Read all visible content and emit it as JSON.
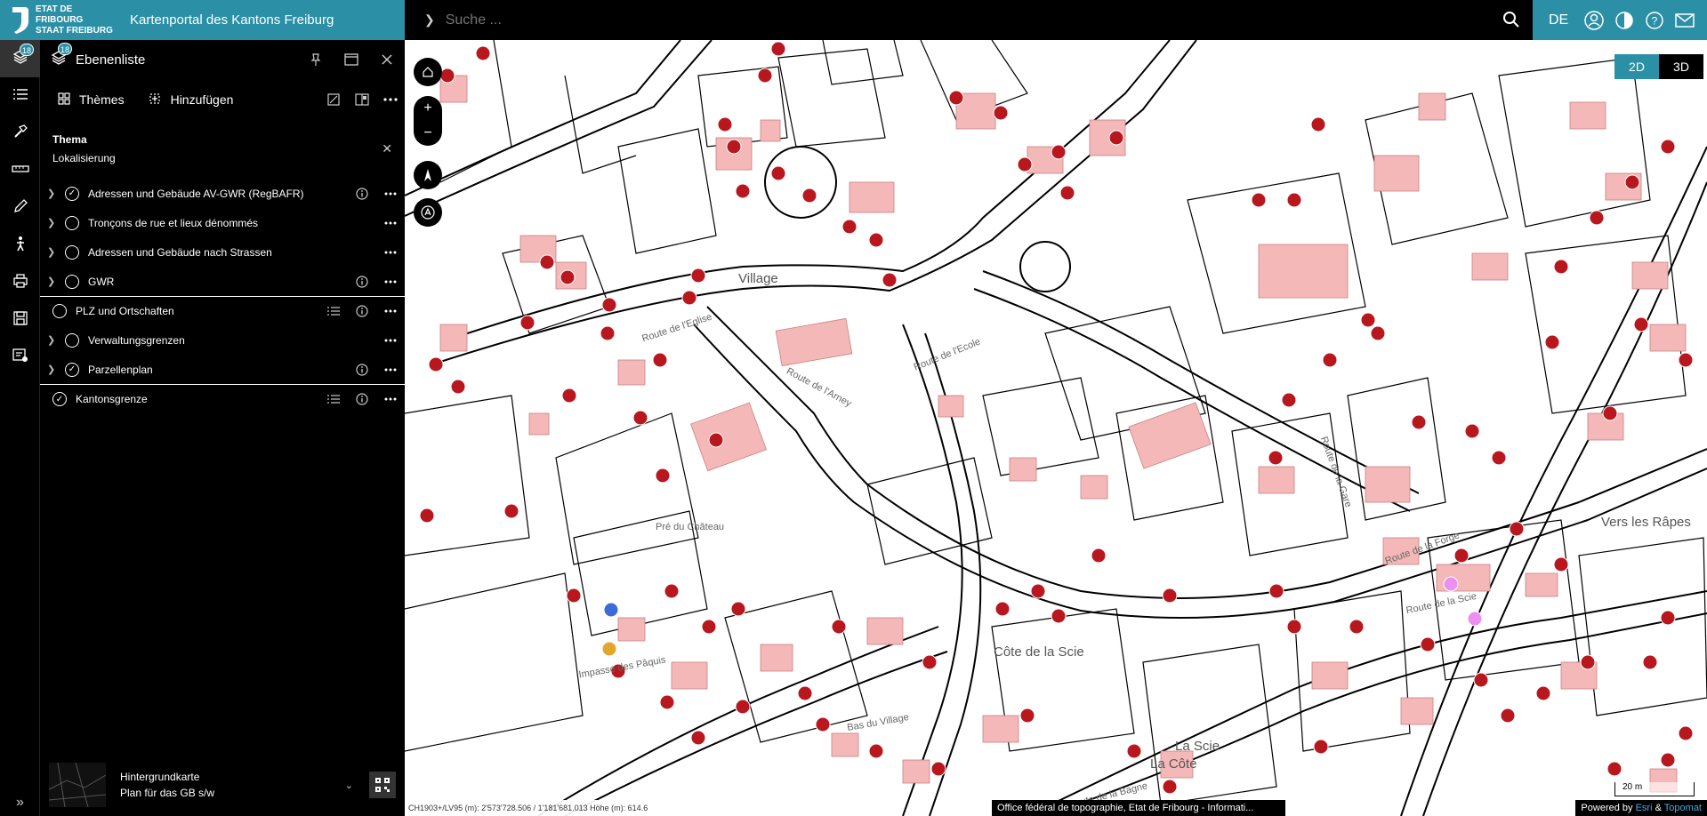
{
  "header": {
    "org_line1": "ETAT DE FRIBOURG",
    "org_line2": "STAAT FREIBURG",
    "portal_title": "Kartenportal des Kantons Freiburg",
    "language": "DE",
    "icons": [
      "user-icon",
      "contrast-icon",
      "help-icon",
      "mail-icon"
    ]
  },
  "search": {
    "placeholder": "Suche ..."
  },
  "rail": {
    "layers_badge": "18",
    "items": [
      "layers-icon",
      "legend-icon",
      "tools-icon",
      "measure-icon",
      "draw-icon",
      "person-icon",
      "print-icon",
      "save-icon",
      "report-icon"
    ]
  },
  "panel": {
    "title": "Ebenenliste",
    "badge": "18",
    "themes_label": "Thèmes",
    "add_label": "Hinzufügen",
    "thema_label": "Thema",
    "thema_value": "Lokalisierung",
    "layers": [
      {
        "label": "Adressen und Gebäude AV-GWR (RegBAFR)",
        "checked": true,
        "expandable": true,
        "info": true,
        "legend": false
      },
      {
        "label": "Tronçons de rue et lieux dénommés",
        "checked": false,
        "expandable": true,
        "info": false,
        "legend": false
      },
      {
        "label": "Adressen und Gebäude nach Strassen",
        "checked": false,
        "expandable": true,
        "info": false,
        "legend": false
      },
      {
        "label": "GWR",
        "checked": false,
        "expandable": true,
        "info": true,
        "legend": false
      },
      {
        "label": "PLZ und Ortschaften",
        "checked": false,
        "expandable": false,
        "info": true,
        "legend": true
      },
      {
        "label": "Verwaltungsgrenzen",
        "checked": false,
        "expandable": true,
        "info": false,
        "legend": false
      },
      {
        "label": "Parzellenplan",
        "checked": true,
        "expandable": true,
        "info": true,
        "legend": false
      },
      {
        "label": "Kantonsgrenze",
        "checked": true,
        "expandable": false,
        "info": true,
        "legend": true
      }
    ],
    "background": {
      "title": "Hintergrundkarte",
      "value": "Plan für das GB s/w"
    }
  },
  "map": {
    "view_2d": "2D",
    "view_3d": "3D",
    "place_names": [
      "Village",
      "Pré du Château",
      "Côte de la Scie",
      "Vers les Râpes",
      "La Côte",
      "La Scie"
    ],
    "street_names": [
      "Route de l'Eglise",
      "Route de l'Ecole",
      "Route de l'Arney",
      "Route de la Forge",
      "Route de la Scie",
      "Route de la Bagne",
      "Impasse des Pâquis",
      "Route de la Gare",
      "Bas du Village"
    ],
    "coords_label": "CH1903+/LV95 (m):",
    "coords_value": "2'573'728.506 / 1'181'681.013",
    "height_label": "Höhe (m):",
    "height_value": "614.6",
    "attribution": "Office fédéral de topographie, Etat de Fribourg - Informati...",
    "powered_by": "Powered by",
    "esri": "Esri",
    "amp": "&",
    "topomat": "Topomat",
    "scale_label": "20 m"
  },
  "colors": {
    "accent": "#2b8fa6",
    "building": "#f4b8b8",
    "marker": "#b8171d"
  }
}
